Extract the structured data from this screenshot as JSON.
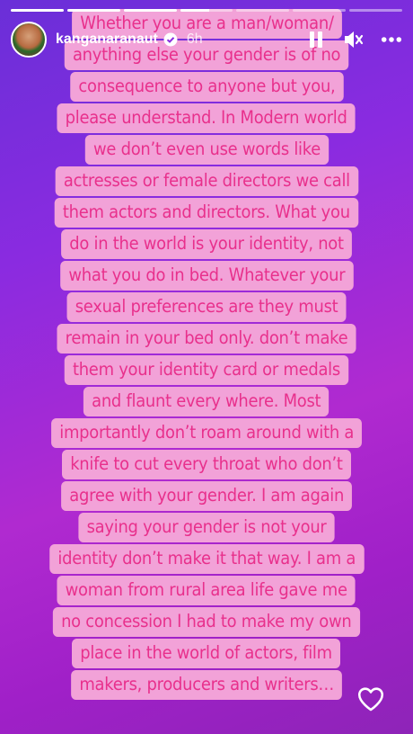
{
  "progress": [
    1,
    1,
    1,
    0.55,
    0,
    0,
    0
  ],
  "header": {
    "username": "kanganaranaut",
    "time": "6h"
  },
  "icons": {
    "verified": "verified-badge-icon",
    "pause": "pause-icon",
    "mute": "mute-icon",
    "more": "more-options-icon",
    "like": "heart-icon"
  },
  "story_lines": [
    "Whether you are a man/woman/",
    "anything else your gender is of no",
    "consequence to anyone but you,",
    "please understand. In Modern world",
    "we don’t even use words like",
    "actresses or female directors we call",
    "them actors and directors. What you",
    "do in the world is your identity, not",
    "what you do in bed. Whatever your",
    "sexual preferences are they must",
    "remain in your bed only. don’t make",
    "them your identity card or medals",
    "and flaunt every where.  Most",
    "importantly don’t roam around with a",
    "knife to cut every throat who don’t",
    "agree with your gender. I am again",
    "saying your gender is not your",
    "identity don’t make it that way.  I am a",
    "woman from rural area life gave me",
    "no concession I had to make my own",
    "place in the world of actors, film",
    "makers, producers and writers…"
  ],
  "colors": {
    "text": "#e8308c",
    "highlight": "#f2a2d8"
  }
}
